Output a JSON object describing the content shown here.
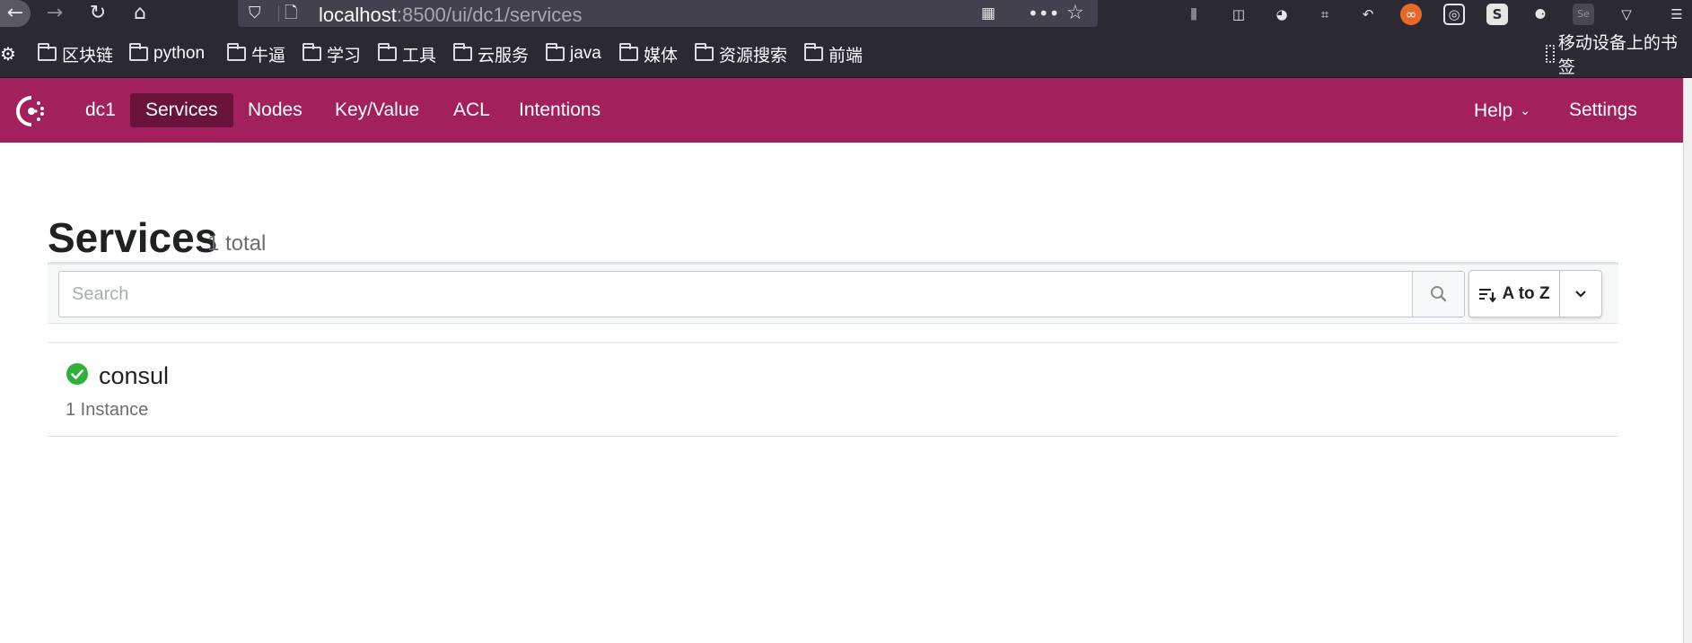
{
  "browser": {
    "url_host": "localhost",
    "url_path": ":8500/ui/dc1/services"
  },
  "bookmarks": {
    "settings_icon": "gear-icon",
    "items": [
      "区块链",
      "python",
      "牛逼",
      "学习",
      "工具",
      "云服务",
      "java",
      "媒体",
      "资源搜索",
      "前端"
    ],
    "mobile": "移动设备上的书签"
  },
  "nav": {
    "datacenter": "dc1",
    "items": [
      "Services",
      "Nodes",
      "Key/Value",
      "ACL",
      "Intentions"
    ],
    "help": "Help",
    "settings": "Settings"
  },
  "page": {
    "title": "Services",
    "count": "1 total"
  },
  "filter": {
    "search_placeholder": "Search",
    "sort_label": "A to Z"
  },
  "services": [
    {
      "name": "consul",
      "instances": "1 Instance",
      "status": "passing"
    }
  ],
  "colors": {
    "brand": "#a2205b",
    "brand_active": "#6a1339",
    "success": "#2eb039"
  }
}
